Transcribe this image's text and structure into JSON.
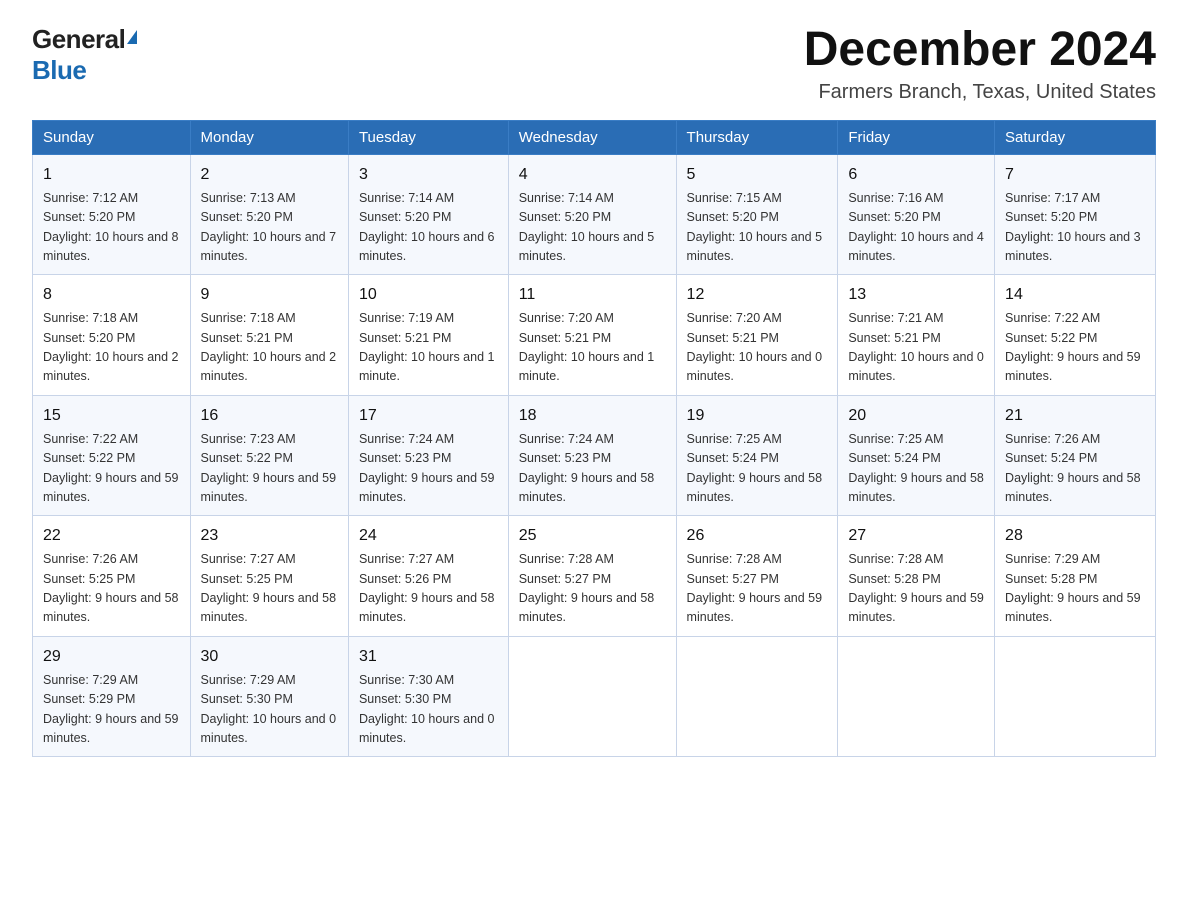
{
  "logo": {
    "general": "General",
    "blue": "Blue"
  },
  "title": "December 2024",
  "subtitle": "Farmers Branch, Texas, United States",
  "weekdays": [
    "Sunday",
    "Monday",
    "Tuesday",
    "Wednesday",
    "Thursday",
    "Friday",
    "Saturday"
  ],
  "weeks": [
    [
      {
        "day": "1",
        "sunrise": "7:12 AM",
        "sunset": "5:20 PM",
        "daylight": "10 hours and 8 minutes."
      },
      {
        "day": "2",
        "sunrise": "7:13 AM",
        "sunset": "5:20 PM",
        "daylight": "10 hours and 7 minutes."
      },
      {
        "day": "3",
        "sunrise": "7:14 AM",
        "sunset": "5:20 PM",
        "daylight": "10 hours and 6 minutes."
      },
      {
        "day": "4",
        "sunrise": "7:14 AM",
        "sunset": "5:20 PM",
        "daylight": "10 hours and 5 minutes."
      },
      {
        "day": "5",
        "sunrise": "7:15 AM",
        "sunset": "5:20 PM",
        "daylight": "10 hours and 5 minutes."
      },
      {
        "day": "6",
        "sunrise": "7:16 AM",
        "sunset": "5:20 PM",
        "daylight": "10 hours and 4 minutes."
      },
      {
        "day": "7",
        "sunrise": "7:17 AM",
        "sunset": "5:20 PM",
        "daylight": "10 hours and 3 minutes."
      }
    ],
    [
      {
        "day": "8",
        "sunrise": "7:18 AM",
        "sunset": "5:20 PM",
        "daylight": "10 hours and 2 minutes."
      },
      {
        "day": "9",
        "sunrise": "7:18 AM",
        "sunset": "5:21 PM",
        "daylight": "10 hours and 2 minutes."
      },
      {
        "day": "10",
        "sunrise": "7:19 AM",
        "sunset": "5:21 PM",
        "daylight": "10 hours and 1 minute."
      },
      {
        "day": "11",
        "sunrise": "7:20 AM",
        "sunset": "5:21 PM",
        "daylight": "10 hours and 1 minute."
      },
      {
        "day": "12",
        "sunrise": "7:20 AM",
        "sunset": "5:21 PM",
        "daylight": "10 hours and 0 minutes."
      },
      {
        "day": "13",
        "sunrise": "7:21 AM",
        "sunset": "5:21 PM",
        "daylight": "10 hours and 0 minutes."
      },
      {
        "day": "14",
        "sunrise": "7:22 AM",
        "sunset": "5:22 PM",
        "daylight": "9 hours and 59 minutes."
      }
    ],
    [
      {
        "day": "15",
        "sunrise": "7:22 AM",
        "sunset": "5:22 PM",
        "daylight": "9 hours and 59 minutes."
      },
      {
        "day": "16",
        "sunrise": "7:23 AM",
        "sunset": "5:22 PM",
        "daylight": "9 hours and 59 minutes."
      },
      {
        "day": "17",
        "sunrise": "7:24 AM",
        "sunset": "5:23 PM",
        "daylight": "9 hours and 59 minutes."
      },
      {
        "day": "18",
        "sunrise": "7:24 AM",
        "sunset": "5:23 PM",
        "daylight": "9 hours and 58 minutes."
      },
      {
        "day": "19",
        "sunrise": "7:25 AM",
        "sunset": "5:24 PM",
        "daylight": "9 hours and 58 minutes."
      },
      {
        "day": "20",
        "sunrise": "7:25 AM",
        "sunset": "5:24 PM",
        "daylight": "9 hours and 58 minutes."
      },
      {
        "day": "21",
        "sunrise": "7:26 AM",
        "sunset": "5:24 PM",
        "daylight": "9 hours and 58 minutes."
      }
    ],
    [
      {
        "day": "22",
        "sunrise": "7:26 AM",
        "sunset": "5:25 PM",
        "daylight": "9 hours and 58 minutes."
      },
      {
        "day": "23",
        "sunrise": "7:27 AM",
        "sunset": "5:25 PM",
        "daylight": "9 hours and 58 minutes."
      },
      {
        "day": "24",
        "sunrise": "7:27 AM",
        "sunset": "5:26 PM",
        "daylight": "9 hours and 58 minutes."
      },
      {
        "day": "25",
        "sunrise": "7:28 AM",
        "sunset": "5:27 PM",
        "daylight": "9 hours and 58 minutes."
      },
      {
        "day": "26",
        "sunrise": "7:28 AM",
        "sunset": "5:27 PM",
        "daylight": "9 hours and 59 minutes."
      },
      {
        "day": "27",
        "sunrise": "7:28 AM",
        "sunset": "5:28 PM",
        "daylight": "9 hours and 59 minutes."
      },
      {
        "day": "28",
        "sunrise": "7:29 AM",
        "sunset": "5:28 PM",
        "daylight": "9 hours and 59 minutes."
      }
    ],
    [
      {
        "day": "29",
        "sunrise": "7:29 AM",
        "sunset": "5:29 PM",
        "daylight": "9 hours and 59 minutes."
      },
      {
        "day": "30",
        "sunrise": "7:29 AM",
        "sunset": "5:30 PM",
        "daylight": "10 hours and 0 minutes."
      },
      {
        "day": "31",
        "sunrise": "7:30 AM",
        "sunset": "5:30 PM",
        "daylight": "10 hours and 0 minutes."
      },
      null,
      null,
      null,
      null
    ]
  ]
}
